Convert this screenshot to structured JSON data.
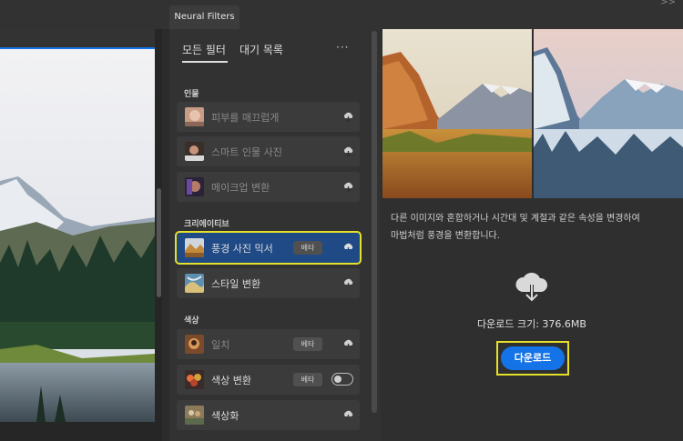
{
  "panel_tab": {
    "title": "Neural Filters",
    "collapse_label": ">>"
  },
  "tabs": {
    "all_filters": "모든 필터",
    "waitlist": "대기 목록",
    "more": "···"
  },
  "sections": {
    "portraits": {
      "label": "인물",
      "items": [
        {
          "label": "피부를 매끄럽게",
          "enabled": false
        },
        {
          "label": "스마트 인물 사진",
          "enabled": false
        },
        {
          "label": "메이크업 변환",
          "enabled": false
        }
      ]
    },
    "creative": {
      "label": "크리에이티브",
      "items": [
        {
          "label": "풍경 사진 믹서",
          "badge": "베타",
          "selected": true
        },
        {
          "label": "스타일 변환"
        }
      ]
    },
    "color": {
      "label": "색상",
      "items": [
        {
          "label": "일치",
          "badge": "베타",
          "enabled": false
        },
        {
          "label": "색상 변환",
          "badge": "베타",
          "toggle": "off"
        },
        {
          "label": "색상화"
        }
      ]
    }
  },
  "info": {
    "description_line1": "다른 이미지와 혼합하거나 시간대 및 계절과 같은 속성을 변경하여",
    "description_line2": "마법처럼 풍경을 변환합니다.",
    "download_size": "다운로드 크기: 376.6MB",
    "download_button": "다운로드"
  },
  "colors": {
    "accent": "#1473e6",
    "highlight": "#e5e02a",
    "selected_row": "#1f4a86"
  }
}
